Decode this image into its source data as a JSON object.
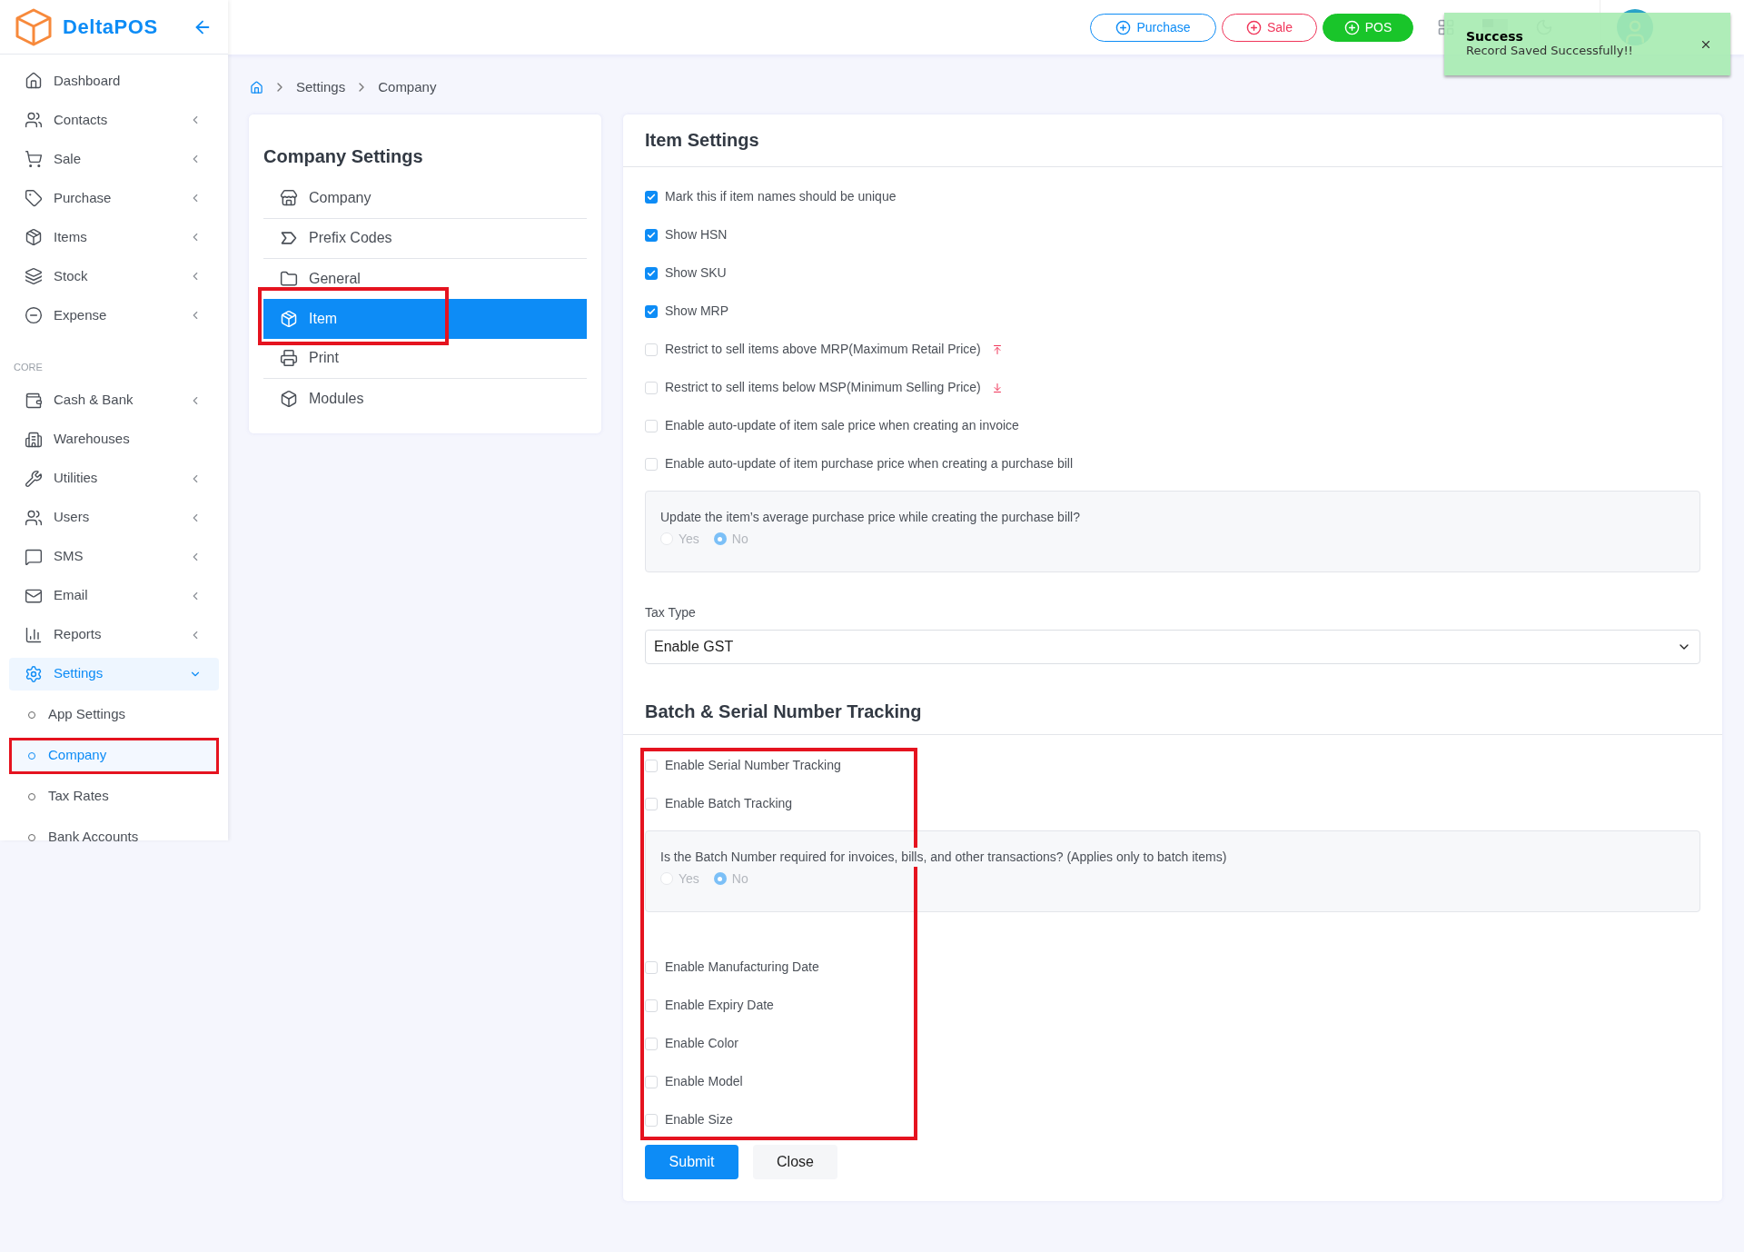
{
  "brand": "DeltaPOS",
  "nav": [
    {
      "label": "Dashboard",
      "kind": "link",
      "selected": false
    },
    {
      "label": "Contacts",
      "kind": "menu",
      "expanded": false,
      "selected": false
    },
    {
      "label": "Sale",
      "kind": "menu",
      "expanded": false,
      "selected": false
    },
    {
      "label": "Purchase",
      "kind": "menu",
      "expanded": false,
      "selected": false
    },
    {
      "label": "Items",
      "kind": "menu",
      "expanded": false,
      "selected": false
    },
    {
      "label": "Stock",
      "kind": "menu",
      "expanded": false,
      "selected": false
    },
    {
      "label": "Expense",
      "kind": "menu",
      "expanded": false,
      "selected": false
    },
    {
      "label": "CORE",
      "kind": "heading"
    },
    {
      "label": "Cash & Bank",
      "kind": "menu",
      "expanded": false,
      "selected": false
    },
    {
      "label": "Warehouses",
      "kind": "link",
      "selected": false
    },
    {
      "label": "Utilities",
      "kind": "menu",
      "expanded": false,
      "selected": false
    },
    {
      "label": "Users",
      "kind": "menu",
      "expanded": false,
      "selected": false
    },
    {
      "label": "SMS",
      "kind": "menu",
      "expanded": false,
      "selected": false
    },
    {
      "label": "Email",
      "kind": "menu",
      "expanded": false,
      "selected": false
    },
    {
      "label": "Reports",
      "kind": "menu",
      "expanded": false,
      "selected": false
    },
    {
      "label": "Settings",
      "kind": "menu",
      "expanded": true,
      "selected": true,
      "children": [
        {
          "label": "App Settings",
          "selected": false,
          "highlighted": false
        },
        {
          "label": "Company",
          "selected": true,
          "highlighted": true
        },
        {
          "label": "Tax Rates",
          "selected": false,
          "highlighted": false
        },
        {
          "label": "Bank Accounts",
          "selected": false,
          "highlighted": false
        }
      ]
    }
  ],
  "topbar": {
    "buttons": [
      {
        "label": "Purchase",
        "kind": "outline-blue"
      },
      {
        "label": "Sale",
        "kind": "outline-red"
      },
      {
        "label": "POS",
        "kind": "solid-green"
      }
    ]
  },
  "toast": {
    "title": "Success",
    "message": "Record Saved Successfully!!"
  },
  "breadcrumb": [
    "Settings",
    "Company"
  ],
  "company_settings": {
    "title": "Company Settings",
    "items": [
      {
        "label": "Company",
        "selected": false,
        "highlighted": false
      },
      {
        "label": "Prefix Codes",
        "selected": false,
        "highlighted": false
      },
      {
        "label": "General",
        "selected": false,
        "highlighted": false
      },
      {
        "label": "Item",
        "selected": true,
        "highlighted": true
      },
      {
        "label": "Print",
        "selected": false,
        "highlighted": false
      },
      {
        "label": "Modules",
        "selected": false,
        "highlighted": false
      }
    ]
  },
  "item_settings": {
    "title": "Item Settings",
    "items": [
      {
        "kind": "checkbox",
        "label": "Mark this if item names should be unique",
        "checked": true
      },
      {
        "kind": "checkbox",
        "label": "Show HSN",
        "checked": true
      },
      {
        "kind": "checkbox",
        "label": "Show SKU",
        "checked": true
      },
      {
        "kind": "checkbox",
        "label": "Show MRP",
        "checked": true
      },
      {
        "kind": "ceiling",
        "label": "Restrict to sell items above MRP(Maximum Retail Price)",
        "checked": false
      },
      {
        "kind": "floor",
        "label": "Restrict to sell items below MSP(Minimum Selling Price)",
        "checked": false
      },
      {
        "kind": "checkbox",
        "label": "Enable auto-update of item sale price when creating an invoice",
        "checked": false
      },
      {
        "kind": "checkbox",
        "label": "Enable auto-update of item purchase price when creating a purchase bill",
        "checked": false
      },
      {
        "kind": "question",
        "label": "Update the item’s average purchase price while creating the purchase bill?",
        "options": [
          {
            "label": "Yes",
            "selected": false
          },
          {
            "label": "No",
            "selected": true
          }
        ]
      }
    ],
    "tax_type": {
      "label": "Tax Type",
      "value": "Enable GST"
    }
  },
  "batch": {
    "title": "Batch & Serial Number Tracking",
    "highlighted": true,
    "items": [
      {
        "kind": "checkbox",
        "label": "Enable Serial Number Tracking",
        "checked": false
      },
      {
        "kind": "checkbox",
        "label": "Enable Batch Tracking",
        "checked": false
      },
      {
        "kind": "question",
        "label": "Is the Batch Number required for invoices, bills, and other transactions? (Applies only to batch items)",
        "options": [
          {
            "label": "Yes",
            "selected": false
          },
          {
            "label": "No",
            "selected": true
          }
        ]
      },
      {
        "kind": "checkbox",
        "label": "Enable Manufacturing Date",
        "checked": false
      },
      {
        "kind": "checkbox",
        "label": "Enable Expiry Date",
        "checked": false
      },
      {
        "kind": "checkbox",
        "label": "Enable Color",
        "checked": false
      },
      {
        "kind": "checkbox",
        "label": "Enable Model",
        "checked": false
      },
      {
        "kind": "checkbox",
        "label": "Enable Size",
        "checked": false
      }
    ]
  },
  "actions": [
    {
      "label": "Submit",
      "kind": "primary"
    },
    {
      "label": "Close",
      "kind": "secondary"
    }
  ]
}
